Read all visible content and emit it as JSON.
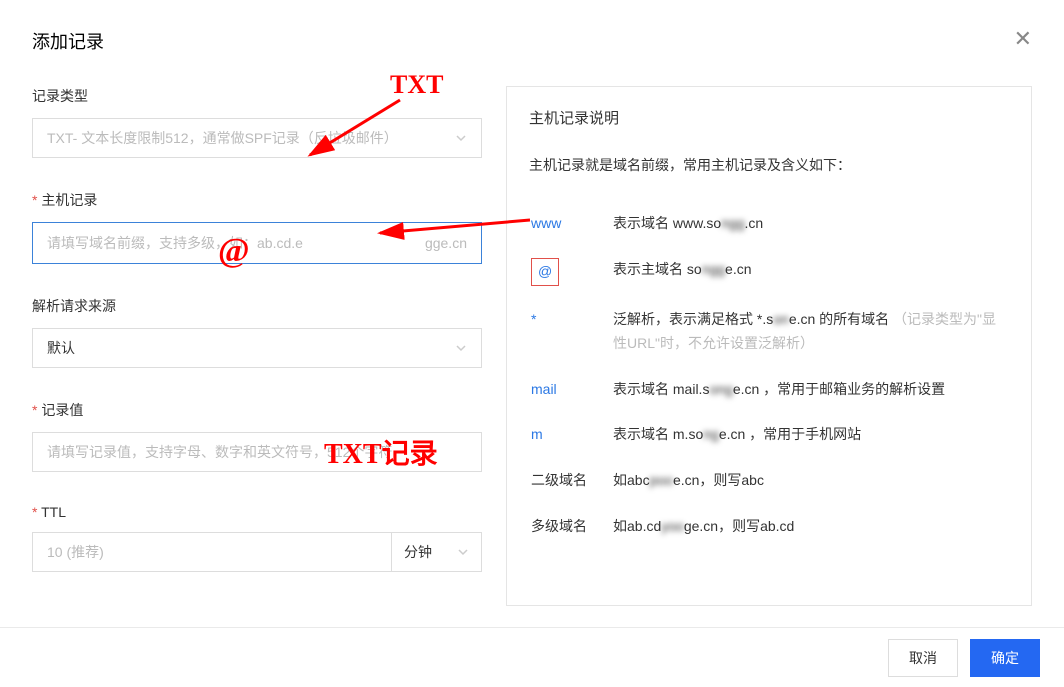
{
  "header": {
    "title": "添加记录"
  },
  "form": {
    "record_type": {
      "label": "记录类型",
      "value": "TXT- 文本长度限制512，通常做SPF记录（反垃圾邮件）"
    },
    "host": {
      "label": "主机记录",
      "placeholder": "请填写域名前缀，支持多级，如：ab.cd.e",
      "suffix": "gge.cn"
    },
    "source": {
      "label": "解析请求来源",
      "value": "默认"
    },
    "value": {
      "label": "记录值",
      "placeholder": "请填写记录值，支持字母、数字和英文符号，512个字符"
    },
    "ttl": {
      "label": "TTL",
      "value": "10 (推荐)",
      "unit": "分钟"
    }
  },
  "help": {
    "title": "主机记录说明",
    "desc": "主机记录就是域名前缀，常用主机记录及含义如下：",
    "rows": [
      {
        "k": "www",
        "v_pre": "表示域名 www.so",
        "v_blur": "ngg",
        "v_post": ".cn"
      },
      {
        "k": "@",
        "boxed": true,
        "v_pre": "表示主域名 so",
        "v_blur": "ngg",
        "v_post": "e.cn"
      },
      {
        "k": "*",
        "v_pre": "泛解析，表示满足格式 *.s",
        "v_blur": "on",
        "v_post": "e.cn 的所有域名",
        "extra": "（记录类型为\"显性URL\"时，不允许设置泛解析）"
      },
      {
        "k": "mail",
        "v_pre": "表示域名 mail.s",
        "v_blur": "ong",
        "v_post": "e.cn ，常用于邮箱业务的解析设置"
      },
      {
        "k": "m",
        "v_pre": "表示域名 m.so",
        "v_blur": "ng",
        "v_post": "e.cn ，常用于手机网站"
      },
      {
        "k": "二级域名",
        "plain": true,
        "v_pre": "如abc",
        "v_blur": "poo",
        "v_post": "e.cn，则写abc"
      },
      {
        "k": "多级域名",
        "plain": true,
        "v_pre": "如ab.cd",
        "v_blur": "yoo",
        "v_post": "ge.cn，则写ab.cd"
      }
    ]
  },
  "footer": {
    "cancel": "取消",
    "confirm": "确定"
  },
  "annotations": {
    "a1": "TXT",
    "a2": "@",
    "a3": "TXT记录"
  }
}
